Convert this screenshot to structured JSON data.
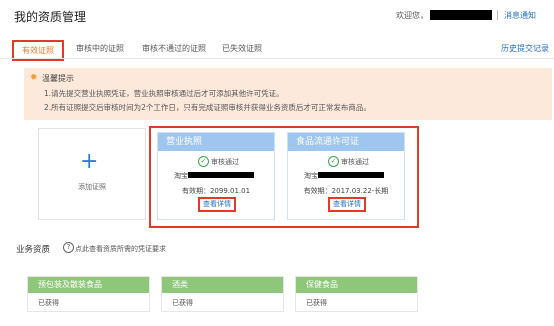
{
  "header": {
    "title": "我的资质管理",
    "welcome": "欢迎您，",
    "messages": "消息通知"
  },
  "tabs": [
    {
      "label": "有效证照",
      "active": true
    },
    {
      "label": "审核中的证照"
    },
    {
      "label": "审核不通过的证照"
    },
    {
      "label": "已失效证照"
    }
  ],
  "history_link": "历史提交记录",
  "notice": {
    "title": "温馨提示",
    "line1": "1.请先提交营业执照凭证，营业执照审核通过后才可添加其他许可凭证。",
    "line2": "2.所有证照提交后审核时间为2个工作日，只有完成证照审核并获得业务资质后才可正常发布商品。"
  },
  "add_card": {
    "label": "添加证照"
  },
  "licenses": [
    {
      "title": "营业执照",
      "status": "审核通过",
      "owner_prefix": "淘宝",
      "validity": "有效期：2099.01.01",
      "detail": "查看详情"
    },
    {
      "title": "食品流通许可证",
      "status": "审核通过",
      "owner_prefix": "淘宝",
      "validity": "有效期：2017.03.22-长期",
      "detail": "查看详情"
    }
  ],
  "business": {
    "title": "业务资质",
    "help_icon": "?",
    "help": "点此查看资质所需的凭证要求",
    "items": [
      {
        "title": "预包装及散装食品",
        "status": "已获得"
      },
      {
        "title": "酒类",
        "status": "已获得"
      },
      {
        "title": "保健食品",
        "status": "已获得"
      }
    ]
  },
  "colors": {
    "accent": "#e13b27",
    "link": "#1f6fc4",
    "card_head_blue": "#9fc6ee",
    "biz_head_green": "#8ec77a",
    "notice_bg": "#fde9dc"
  },
  "icons": {
    "plus": "+",
    "check": "✓",
    "bulb": "✹"
  }
}
